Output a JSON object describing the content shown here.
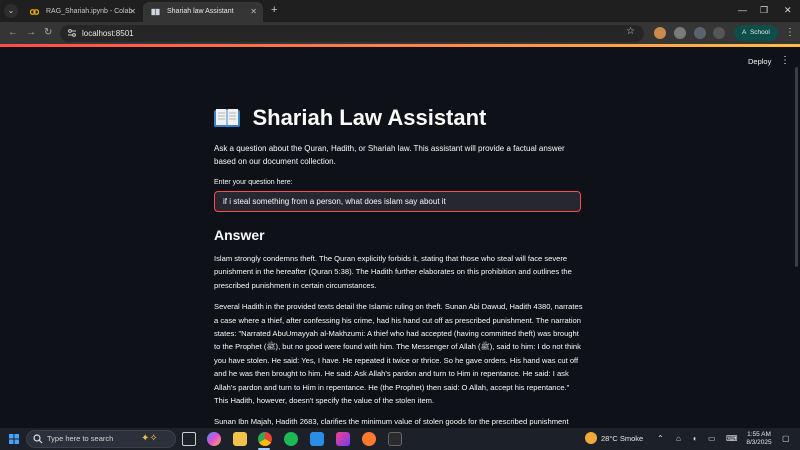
{
  "browser": {
    "tabs": [
      {
        "label": "RAG_Shariah.ipynb - Colab",
        "active": false
      },
      {
        "label": "Shariah law Assistant",
        "active": true
      }
    ],
    "url": "localhost:8501",
    "profile_label": "School",
    "profile_initial": "A"
  },
  "app": {
    "deploy_label": "Deploy",
    "title": "Shariah Law Assistant",
    "intro": "Ask a question about the Quran, Hadith, or Shariah law. This assistant will provide a factual answer based on our document collection.",
    "input_label": "Enter your question here:",
    "question": "if i steal something from a person, what does islam say about it",
    "answer_heading": "Answer",
    "answer_paragraphs": [
      "Islam strongly condemns theft. The Quran explicitly forbids it, stating that those who steal will face severe punishment in the hereafter (Quran 5:38). The Hadith further elaborates on this prohibition and outlines the prescribed punishment in certain circumstances.",
      "Several Hadith in the provided texts detail the Islamic ruling on theft. Sunan Abi Dawud, Hadith 4380, narrates a case where a thief, after confessing his crime, had his hand cut off as prescribed punishment. The narration states: \"Narrated AbuUmayyah al-Makhzumi: A thief who had accepted (having committed theft) was brought to the Prophet (ﷺ), but no good were found with him. The Messenger of Allah (ﷺ), said to him: I do not think you have stolen. He said: Yes, I have. He repeated it twice or thrice. So he gave orders. His hand was cut off and he was then brought to him. He said: Ask Allah's pardon and turn to Him in repentance. He said: I ask Allah's pardon and turn to Him in repentance. He (the Prophet) then said: O Allah, accept his repentance.\" This Hadith, however, doesn't specify the value of the stolen item.",
      "Sunan Ibn Majah, Hadith 2683, clarifies the minimum value of stolen goods for the prescribed punishment"
    ]
  },
  "taskbar": {
    "search_placeholder": "Type here to search",
    "weather": "28°C  Smoke",
    "time": "1:55 AM",
    "date": "8/3/2025"
  },
  "colors": {
    "app_bg": "#0e1117",
    "accent": "#ff4b4b",
    "input_bg": "#262730"
  }
}
